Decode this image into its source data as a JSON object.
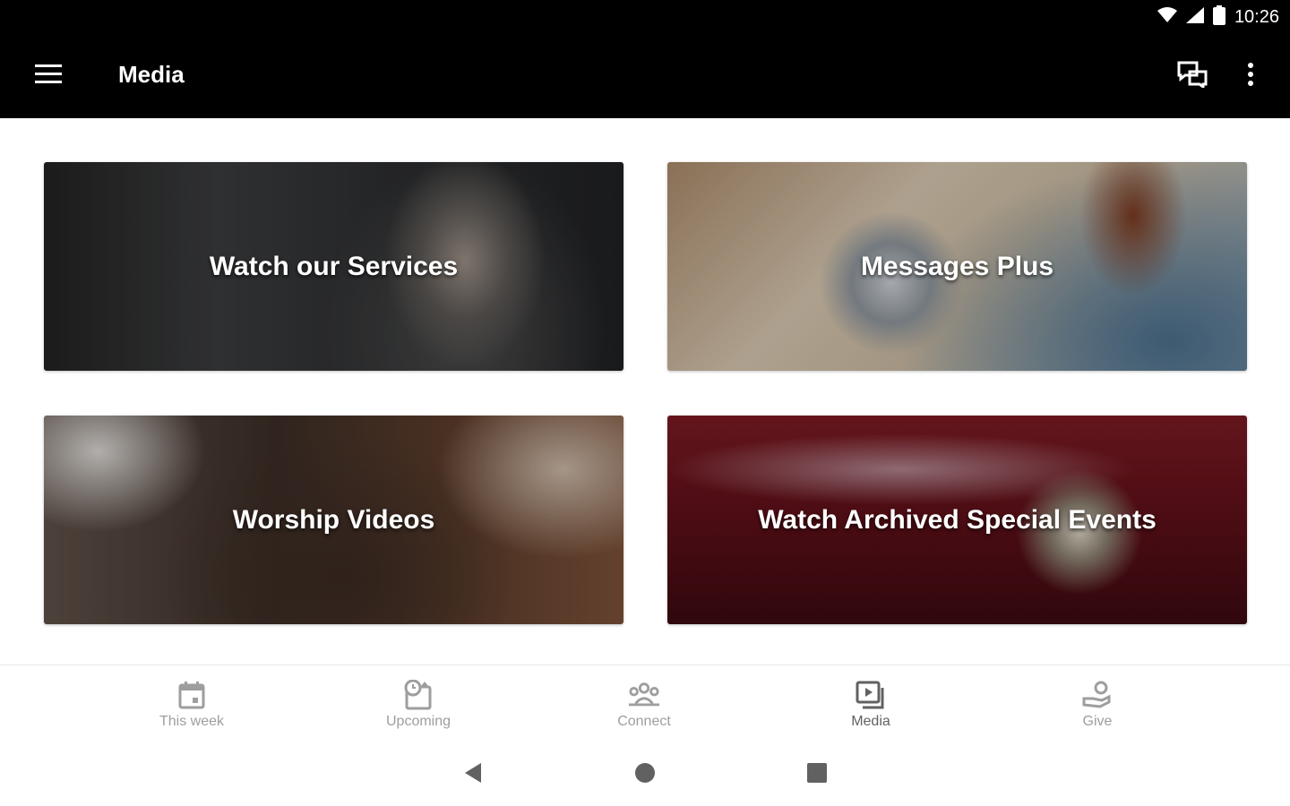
{
  "status_bar": {
    "time": "10:26",
    "icons": [
      "wifi-icon",
      "signal-icon",
      "battery-icon"
    ]
  },
  "app_bar": {
    "title": "Media",
    "icons": [
      "menu-icon",
      "chat-icon",
      "more-vert-icon"
    ]
  },
  "cards": [
    {
      "label": "Watch our Services"
    },
    {
      "label": "Messages Plus"
    },
    {
      "label": "Worship Videos"
    },
    {
      "label": "Watch Archived Special Events"
    }
  ],
  "bottom_nav": {
    "items": [
      {
        "label": "This week",
        "icon": "calendar-icon",
        "active": false
      },
      {
        "label": "Upcoming",
        "icon": "upcoming-icon",
        "active": false
      },
      {
        "label": "Connect",
        "icon": "group-icon",
        "active": false
      },
      {
        "label": "Media",
        "icon": "media-icon",
        "active": true
      },
      {
        "label": "Give",
        "icon": "give-icon",
        "active": false
      }
    ]
  },
  "system_nav": {
    "icons": [
      "back-icon",
      "home-icon",
      "recents-icon"
    ]
  },
  "colors": {
    "app_bar_bg": "#000000",
    "nav_label": "#9e9e9e",
    "nav_label_active": "#616161"
  }
}
